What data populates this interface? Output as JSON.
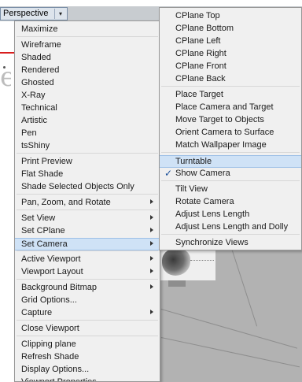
{
  "viewport": {
    "title": "Perspective",
    "dropdown_glyph": "▾"
  },
  "background": {
    "letter": "e"
  },
  "menu": {
    "items": [
      {
        "label": "Maximize",
        "submenu": false
      },
      {
        "label": "Wireframe",
        "submenu": false
      },
      {
        "label": "Shaded",
        "submenu": false
      },
      {
        "label": "Rendered",
        "submenu": false
      },
      {
        "label": "Ghosted",
        "submenu": false
      },
      {
        "label": "X-Ray",
        "submenu": false
      },
      {
        "label": "Technical",
        "submenu": false
      },
      {
        "label": "Artistic",
        "submenu": false
      },
      {
        "label": "Pen",
        "submenu": false
      },
      {
        "label": "tsShiny",
        "submenu": false
      },
      {
        "label": "Print Preview",
        "submenu": false
      },
      {
        "label": "Flat Shade",
        "submenu": false
      },
      {
        "label": "Shade Selected Objects Only",
        "submenu": false
      },
      {
        "label": "Pan, Zoom, and Rotate",
        "submenu": true
      },
      {
        "label": "Set View",
        "submenu": true
      },
      {
        "label": "Set CPlane",
        "submenu": true
      },
      {
        "label": "Set Camera",
        "submenu": true,
        "highlighted": true
      },
      {
        "label": "Active Viewport",
        "submenu": true
      },
      {
        "label": "Viewport Layout",
        "submenu": true
      },
      {
        "label": "Background Bitmap",
        "submenu": true
      },
      {
        "label": "Grid Options...",
        "submenu": false
      },
      {
        "label": "Capture",
        "submenu": true
      },
      {
        "label": "Close Viewport",
        "submenu": false
      },
      {
        "label": "Clipping plane",
        "submenu": false
      },
      {
        "label": "Refresh Shade",
        "submenu": false
      },
      {
        "label": "Display Options...",
        "submenu": false
      },
      {
        "label": "Viewport Properties",
        "submenu": false
      }
    ]
  },
  "submenu": {
    "items": [
      {
        "label": "CPlane Top"
      },
      {
        "label": "CPlane Bottom"
      },
      {
        "label": "CPlane Left"
      },
      {
        "label": "CPlane Right"
      },
      {
        "label": "CPlane Front"
      },
      {
        "label": "CPlane Back"
      },
      {
        "label": "Place Target"
      },
      {
        "label": "Place Camera and Target"
      },
      {
        "label": "Move Target to Objects"
      },
      {
        "label": "Orient Camera to Surface"
      },
      {
        "label": "Match Wallpaper Image"
      },
      {
        "label": "Turntable",
        "highlighted": true
      },
      {
        "label": "Show Camera",
        "checked": true
      },
      {
        "label": "Tilt View"
      },
      {
        "label": "Rotate Camera"
      },
      {
        "label": "Adjust Lens Length"
      },
      {
        "label": "Adjust Lens Length and Dolly"
      },
      {
        "label": "Synchronize Views"
      }
    ],
    "check_glyph": "✓"
  },
  "colors": {
    "menu_bg": "#f0f0f0",
    "highlight": "#cfe2f6",
    "highlight_border": "#9dc0e6",
    "viewport_gray": "#b2b2b2",
    "accent_red": "#d81e1e"
  }
}
